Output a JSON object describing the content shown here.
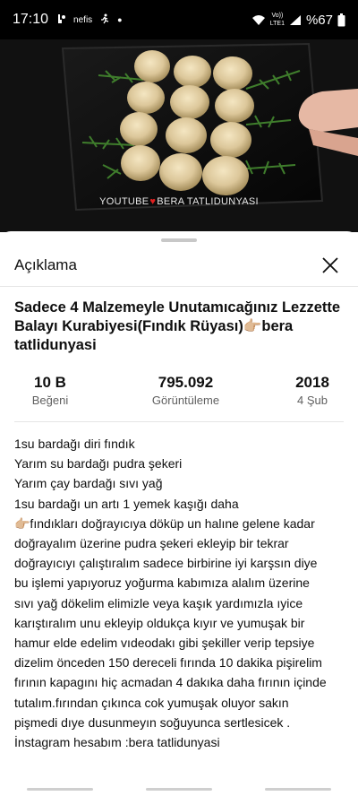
{
  "status_bar": {
    "time": "17:10",
    "network_label": "nefis",
    "network_badge": "Vo))\nLTE1",
    "battery": "%67",
    "icons": [
      "notification-icon",
      "runner-icon",
      "dot-icon",
      "wifi-icon",
      "signal-icon",
      "battery-icon"
    ]
  },
  "video": {
    "watermark_left": "YOUTUBE",
    "watermark_right": "BERA TATLIDUNYASI"
  },
  "sheet": {
    "title": "Açıklama",
    "close_icon": "close-icon"
  },
  "video_title": "Sadece 4 Malzemeyle Unutamıcağınız Lezzette Balayı Kurabiyesi(Fındık Rüyası)👉🏼bera tatlidunyasi",
  "stats": {
    "likes": {
      "value": "10 B",
      "label": "Beğeni"
    },
    "views": {
      "value": "795.092",
      "label": "Görüntüleme"
    },
    "date": {
      "value": "2018",
      "label": "4 Şub"
    }
  },
  "description_lines": [
    "1su bardağı diri fındık",
    "Yarım su bardağı pudra şekeri",
    "Yarım çay bardağı sıvı yağ",
    "1su bardağı un artı 1 yemek kaşığı daha",
    "👉🏼fındıkları doğrayıcıya döküp un halıne gelene kadar",
    "doğrayalım üzerine pudra şekeri ekleyip bir tekrar",
    "doğrayıcıyı çalıştıralım sadece birbirine iyi karşsın diye",
    "bu işlemi yapıyoruz yoğurma kabımıza alalım üzerine",
    "sıvı yağ dökelim elimizle veya kaşık yardımızla ıyice",
    "karıştıralım unu ekleyip oldukça kıyır ve yumuşak bir",
    "hamur elde edelim vıdeodakı gibi şekiller verip tepsiye",
    "dizelim önceden 150 dereceli fırında 10 dakika pişirelim",
    "fırının kapagını hiç acmadan 4 dakıka daha fırının içinde",
    "tutalım.fırından çıkınca cok yumuşak oluyor sakın",
    "pişmedi dıye dusunmeyın soğuyunca sertlesicek .",
    "İnstagram hesabım :bera tatlidunyasi"
  ]
}
